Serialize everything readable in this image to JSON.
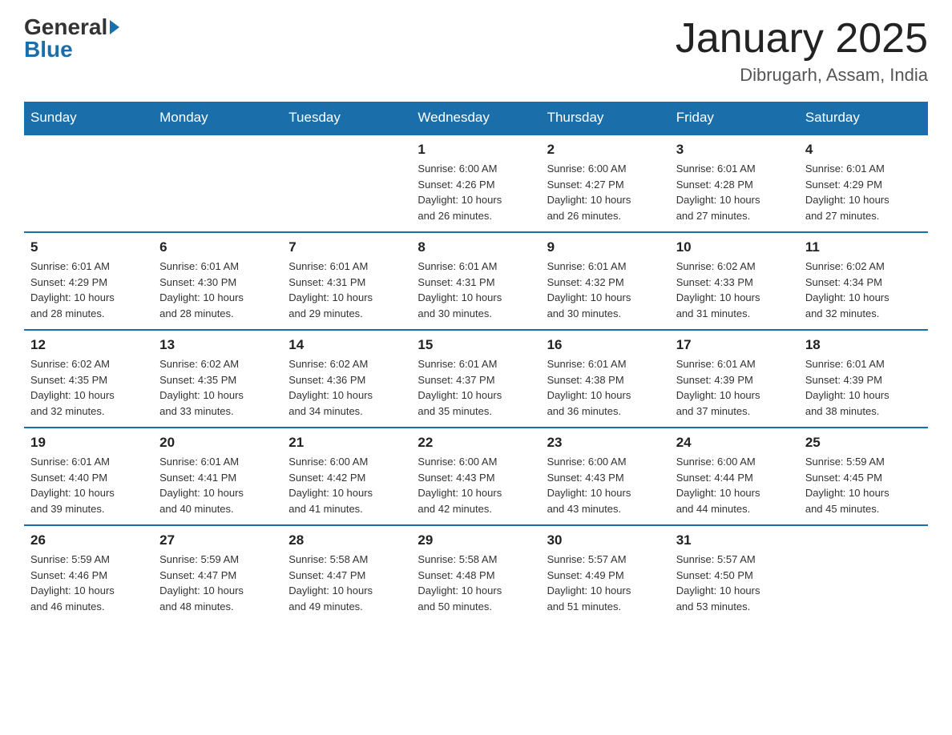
{
  "header": {
    "logo_general": "General",
    "logo_blue": "Blue",
    "month_title": "January 2025",
    "location": "Dibrugarh, Assam, India"
  },
  "days_of_week": [
    "Sunday",
    "Monday",
    "Tuesday",
    "Wednesday",
    "Thursday",
    "Friday",
    "Saturday"
  ],
  "weeks": [
    [
      {
        "day": "",
        "info": ""
      },
      {
        "day": "",
        "info": ""
      },
      {
        "day": "",
        "info": ""
      },
      {
        "day": "1",
        "info": "Sunrise: 6:00 AM\nSunset: 4:26 PM\nDaylight: 10 hours\nand 26 minutes."
      },
      {
        "day": "2",
        "info": "Sunrise: 6:00 AM\nSunset: 4:27 PM\nDaylight: 10 hours\nand 26 minutes."
      },
      {
        "day": "3",
        "info": "Sunrise: 6:01 AM\nSunset: 4:28 PM\nDaylight: 10 hours\nand 27 minutes."
      },
      {
        "day": "4",
        "info": "Sunrise: 6:01 AM\nSunset: 4:29 PM\nDaylight: 10 hours\nand 27 minutes."
      }
    ],
    [
      {
        "day": "5",
        "info": "Sunrise: 6:01 AM\nSunset: 4:29 PM\nDaylight: 10 hours\nand 28 minutes."
      },
      {
        "day": "6",
        "info": "Sunrise: 6:01 AM\nSunset: 4:30 PM\nDaylight: 10 hours\nand 28 minutes."
      },
      {
        "day": "7",
        "info": "Sunrise: 6:01 AM\nSunset: 4:31 PM\nDaylight: 10 hours\nand 29 minutes."
      },
      {
        "day": "8",
        "info": "Sunrise: 6:01 AM\nSunset: 4:31 PM\nDaylight: 10 hours\nand 30 minutes."
      },
      {
        "day": "9",
        "info": "Sunrise: 6:01 AM\nSunset: 4:32 PM\nDaylight: 10 hours\nand 30 minutes."
      },
      {
        "day": "10",
        "info": "Sunrise: 6:02 AM\nSunset: 4:33 PM\nDaylight: 10 hours\nand 31 minutes."
      },
      {
        "day": "11",
        "info": "Sunrise: 6:02 AM\nSunset: 4:34 PM\nDaylight: 10 hours\nand 32 minutes."
      }
    ],
    [
      {
        "day": "12",
        "info": "Sunrise: 6:02 AM\nSunset: 4:35 PM\nDaylight: 10 hours\nand 32 minutes."
      },
      {
        "day": "13",
        "info": "Sunrise: 6:02 AM\nSunset: 4:35 PM\nDaylight: 10 hours\nand 33 minutes."
      },
      {
        "day": "14",
        "info": "Sunrise: 6:02 AM\nSunset: 4:36 PM\nDaylight: 10 hours\nand 34 minutes."
      },
      {
        "day": "15",
        "info": "Sunrise: 6:01 AM\nSunset: 4:37 PM\nDaylight: 10 hours\nand 35 minutes."
      },
      {
        "day": "16",
        "info": "Sunrise: 6:01 AM\nSunset: 4:38 PM\nDaylight: 10 hours\nand 36 minutes."
      },
      {
        "day": "17",
        "info": "Sunrise: 6:01 AM\nSunset: 4:39 PM\nDaylight: 10 hours\nand 37 minutes."
      },
      {
        "day": "18",
        "info": "Sunrise: 6:01 AM\nSunset: 4:39 PM\nDaylight: 10 hours\nand 38 minutes."
      }
    ],
    [
      {
        "day": "19",
        "info": "Sunrise: 6:01 AM\nSunset: 4:40 PM\nDaylight: 10 hours\nand 39 minutes."
      },
      {
        "day": "20",
        "info": "Sunrise: 6:01 AM\nSunset: 4:41 PM\nDaylight: 10 hours\nand 40 minutes."
      },
      {
        "day": "21",
        "info": "Sunrise: 6:00 AM\nSunset: 4:42 PM\nDaylight: 10 hours\nand 41 minutes."
      },
      {
        "day": "22",
        "info": "Sunrise: 6:00 AM\nSunset: 4:43 PM\nDaylight: 10 hours\nand 42 minutes."
      },
      {
        "day": "23",
        "info": "Sunrise: 6:00 AM\nSunset: 4:43 PM\nDaylight: 10 hours\nand 43 minutes."
      },
      {
        "day": "24",
        "info": "Sunrise: 6:00 AM\nSunset: 4:44 PM\nDaylight: 10 hours\nand 44 minutes."
      },
      {
        "day": "25",
        "info": "Sunrise: 5:59 AM\nSunset: 4:45 PM\nDaylight: 10 hours\nand 45 minutes."
      }
    ],
    [
      {
        "day": "26",
        "info": "Sunrise: 5:59 AM\nSunset: 4:46 PM\nDaylight: 10 hours\nand 46 minutes."
      },
      {
        "day": "27",
        "info": "Sunrise: 5:59 AM\nSunset: 4:47 PM\nDaylight: 10 hours\nand 48 minutes."
      },
      {
        "day": "28",
        "info": "Sunrise: 5:58 AM\nSunset: 4:47 PM\nDaylight: 10 hours\nand 49 minutes."
      },
      {
        "day": "29",
        "info": "Sunrise: 5:58 AM\nSunset: 4:48 PM\nDaylight: 10 hours\nand 50 minutes."
      },
      {
        "day": "30",
        "info": "Sunrise: 5:57 AM\nSunset: 4:49 PM\nDaylight: 10 hours\nand 51 minutes."
      },
      {
        "day": "31",
        "info": "Sunrise: 5:57 AM\nSunset: 4:50 PM\nDaylight: 10 hours\nand 53 minutes."
      },
      {
        "day": "",
        "info": ""
      }
    ]
  ]
}
